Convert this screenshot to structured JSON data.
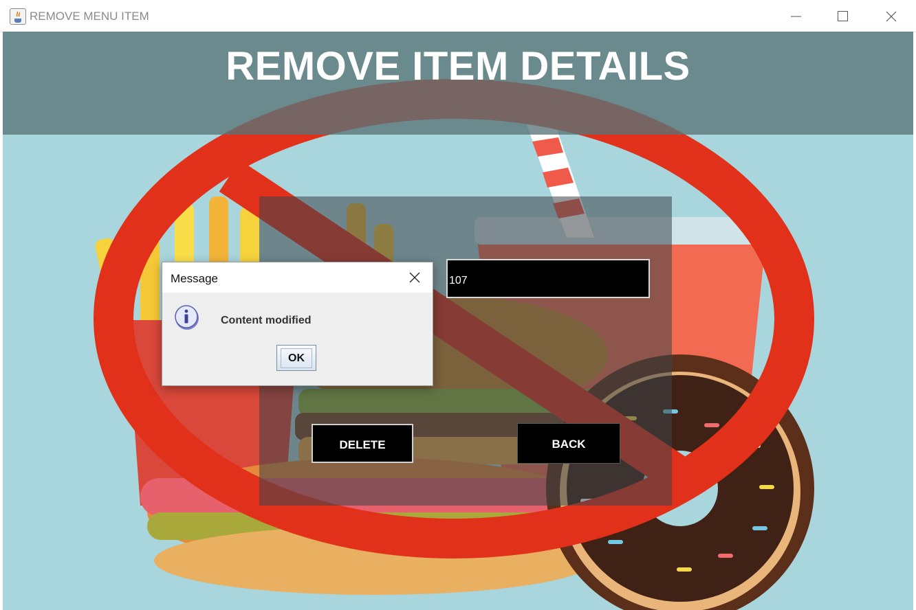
{
  "window": {
    "title": "REMOVE MENU ITEM",
    "icons": {
      "app": "java-app-icon",
      "minimize": "minimize-icon",
      "maximize": "maximize-icon",
      "close": "close-icon"
    }
  },
  "banner": {
    "title": "REMOVE ITEM DETAILS"
  },
  "form": {
    "item_id_value": "107",
    "delete_label": "DELETE",
    "back_label": "BACK"
  },
  "dialog": {
    "title": "Message",
    "message": "Content modified",
    "ok_label": "OK",
    "icons": {
      "info": "info-icon",
      "close": "close-icon"
    }
  },
  "colors": {
    "background": "#a9d5dc",
    "banner": "#587479",
    "prohibition_sign": "#e1311b",
    "field_bg": "#000000"
  }
}
